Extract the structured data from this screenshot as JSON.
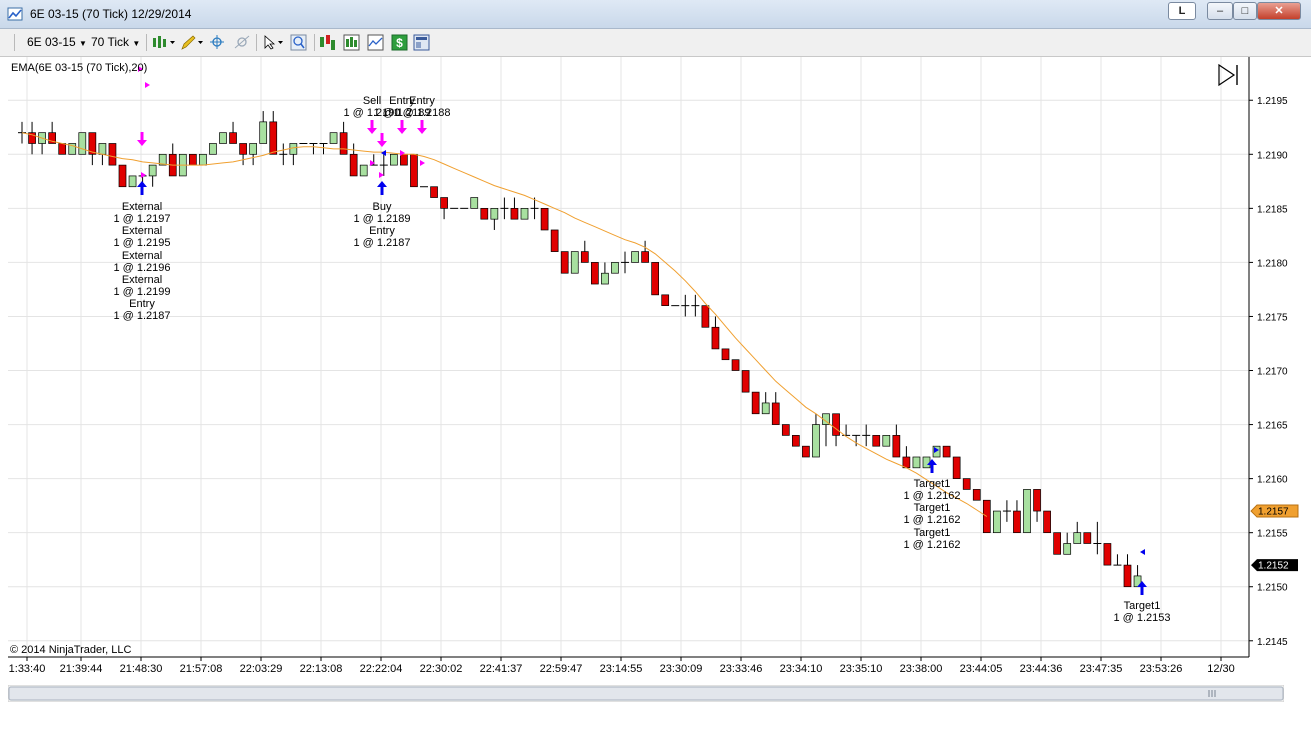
{
  "window": {
    "title": "6E 03-15 (70 Tick)  12/29/2014",
    "btn_l": "L",
    "btn_min": "–",
    "btn_max": "□",
    "btn_close": "✕"
  },
  "toolbar": {
    "instrument": "6E 03-15",
    "interval": "70 Tick",
    "icons": [
      "bar-style-icon",
      "pencil-draw-icon",
      "crosshair-icon",
      "magnet-icon",
      "pointer-icon",
      "zoom-icon",
      "strategies-icon",
      "indicators-icon",
      "chart-style-icon",
      "dollar-icon",
      "properties-icon"
    ]
  },
  "chart": {
    "indicator_label": "EMA(6E 03-15 (70 Tick),20)",
    "copyright": "© 2014 NinjaTrader, LLC",
    "ema_color": "#f0a030",
    "up_color": "#a8e0a0",
    "down_color": "#e00000",
    "ema_price_label": "1.2157",
    "last_price_label": "1.2152",
    "ema_price_value": 1.2157,
    "last_price_value": 1.2152,
    "y_ticks": [
      "1.2195",
      "1.2190",
      "1.2185",
      "1.2180",
      "1.2175",
      "1.2170",
      "1.2165",
      "1.2160",
      "1.2155",
      "1.2150",
      "1.2145"
    ],
    "x_labels": [
      "1:33:40",
      "21:39:44",
      "21:48:30",
      "21:57:08",
      "22:03:29",
      "22:13:08",
      "22:22:04",
      "22:30:02",
      "22:41:37",
      "22:59:47",
      "23:14:55",
      "23:30:09",
      "23:33:46",
      "23:34:10",
      "23:35:10",
      "23:38:00",
      "23:44:05",
      "23:44:36",
      "23:47:35",
      "23:53:26",
      "12/30"
    ],
    "annotations": {
      "left_exec": [
        "External",
        "1 @ 1.2197",
        "External",
        "1 @ 1.2195",
        "External",
        "1 @ 1.2196",
        "External",
        "1 @ 1.2199",
        "Entry",
        "1 @ 1.2187"
      ],
      "mid_buy": [
        "Buy",
        "1 @ 1.2189",
        "Entry",
        "1 @ 1.2187"
      ],
      "top_sell": [
        "Sell",
        "1 @ 1.2190"
      ],
      "top_entry1": [
        "Entry",
        "1 @ 1.2189"
      ],
      "top_entry2": [
        "Entry",
        "1 @ 1.2188"
      ],
      "target_group": [
        "Target1",
        "1 @ 1.2162",
        "Target1",
        "1 @ 1.2162",
        "Target1",
        "1 @ 1.2162"
      ],
      "target_last": [
        "Target1",
        "1 @ 1.2153"
      ]
    }
  },
  "chart_data": {
    "type": "candlestick",
    "title": "",
    "ylim": [
      1.21435,
      1.2199
    ],
    "grid": true,
    "series": [
      {
        "name": "EMA(6E 03-15 (70 Tick),20)",
        "values": [
          1.2192,
          1.21918,
          1.21915,
          1.21912,
          1.2191,
          1.21908,
          1.21905,
          1.21902,
          1.219,
          1.21898,
          1.21896,
          1.21895,
          1.21893,
          1.21892,
          1.21891,
          1.2189,
          1.2189,
          1.2189,
          1.2189,
          1.21891,
          1.21892,
          1.21893,
          1.21895,
          1.21897,
          1.21899,
          1.21902,
          1.21904,
          1.21906,
          1.21907,
          1.21907,
          1.21906,
          1.21905,
          1.21905,
          1.21904,
          1.21903,
          1.21902,
          1.21902,
          1.21901,
          1.219,
          1.219,
          1.21898,
          1.21895,
          1.21891,
          1.21887,
          1.21883,
          1.21879,
          1.21875,
          1.21871,
          1.21868,
          1.21865,
          1.21862,
          1.21858,
          1.21854,
          1.2185,
          1.21846,
          1.21841,
          1.21837,
          1.21833,
          1.21829,
          1.21825,
          1.21821,
          1.21818,
          1.21814,
          1.21808,
          1.218,
          1.21792,
          1.21783,
          1.21773,
          1.21762,
          1.21752,
          1.21741,
          1.2173,
          1.2172,
          1.2171,
          1.217,
          1.2169,
          1.21682,
          1.21674,
          1.21666,
          1.2166,
          1.21653,
          1.21646,
          1.21639,
          1.21633,
          1.21628,
          1.21623,
          1.21618,
          1.21614,
          1.2161,
          1.21605,
          1.21599,
          1.21593,
          1.21587,
          1.21582,
          1.21577,
          1.21571,
          1.21565
        ]
      }
    ],
    "candles": [
      [
        1.2192,
        1.2193,
        1.2191,
        1.2192
      ],
      [
        1.2192,
        1.2193,
        1.219,
        1.2191
      ],
      [
        1.2191,
        1.2192,
        1.219,
        1.2192
      ],
      [
        1.2192,
        1.2193,
        1.2191,
        1.2191
      ],
      [
        1.2191,
        1.2191,
        1.219,
        1.219
      ],
      [
        1.219,
        1.2191,
        1.219,
        1.2191
      ],
      [
        1.219,
        1.2192,
        1.219,
        1.2192
      ],
      [
        1.2192,
        1.2192,
        1.2189,
        1.219
      ],
      [
        1.219,
        1.2191,
        1.2189,
        1.2191
      ],
      [
        1.2191,
        1.2191,
        1.2189,
        1.2189
      ],
      [
        1.2189,
        1.2189,
        1.2187,
        1.2187
      ],
      [
        1.2187,
        1.2188,
        1.2187,
        1.2188
      ],
      [
        1.2188,
        1.2188,
        1.2187,
        1.2188
      ],
      [
        1.2188,
        1.2189,
        1.2187,
        1.2189
      ],
      [
        1.2189,
        1.219,
        1.2189,
        1.219
      ],
      [
        1.219,
        1.2191,
        1.2188,
        1.2188
      ],
      [
        1.2188,
        1.219,
        1.2188,
        1.219
      ],
      [
        1.219,
        1.219,
        1.2189,
        1.2189
      ],
      [
        1.2189,
        1.219,
        1.2189,
        1.219
      ],
      [
        1.219,
        1.2191,
        1.219,
        1.2191
      ],
      [
        1.2191,
        1.2192,
        1.2191,
        1.2192
      ],
      [
        1.2192,
        1.2193,
        1.2191,
        1.2191
      ],
      [
        1.2191,
        1.2191,
        1.2189,
        1.219
      ],
      [
        1.219,
        1.2191,
        1.2189,
        1.2191
      ],
      [
        1.2191,
        1.2194,
        1.2191,
        1.2193
      ],
      [
        1.2193,
        1.2194,
        1.219,
        1.219
      ],
      [
        1.219,
        1.2191,
        1.2189,
        1.219
      ],
      [
        1.219,
        1.2191,
        1.2189,
        1.2191
      ],
      [
        1.2191,
        1.2191,
        1.2191,
        1.2191
      ],
      [
        1.2191,
        1.2191,
        1.219,
        1.2191
      ],
      [
        1.2191,
        1.2191,
        1.219,
        1.2191
      ],
      [
        1.2191,
        1.2192,
        1.2191,
        1.2192
      ],
      [
        1.2192,
        1.2193,
        1.219,
        1.219
      ],
      [
        1.219,
        1.2191,
        1.2188,
        1.2188
      ],
      [
        1.2188,
        1.2189,
        1.2188,
        1.2189
      ],
      [
        1.2189,
        1.219,
        1.2189,
        1.2189
      ],
      [
        1.2189,
        1.219,
        1.2188,
        1.2189
      ],
      [
        1.2189,
        1.219,
        1.2189,
        1.219
      ],
      [
        1.219,
        1.219,
        1.2189,
        1.2189
      ],
      [
        1.219,
        1.219,
        1.2187,
        1.2187
      ],
      [
        1.2187,
        1.2187,
        1.2187,
        1.2187
      ],
      [
        1.2187,
        1.2187,
        1.2186,
        1.2186
      ],
      [
        1.2186,
        1.2186,
        1.2184,
        1.2185
      ],
      [
        1.2185,
        1.2185,
        1.2185,
        1.2185
      ],
      [
        1.2185,
        1.2185,
        1.2185,
        1.2185
      ],
      [
        1.2185,
        1.2186,
        1.2185,
        1.2186
      ],
      [
        1.2185,
        1.2185,
        1.2184,
        1.2184
      ],
      [
        1.2184,
        1.2185,
        1.2183,
        1.2185
      ],
      [
        1.2185,
        1.2186,
        1.2184,
        1.2185
      ],
      [
        1.2185,
        1.2186,
        1.2185,
        1.2184
      ],
      [
        1.2184,
        1.2185,
        1.2184,
        1.2185
      ],
      [
        1.2185,
        1.2186,
        1.2184,
        1.2185
      ],
      [
        1.2185,
        1.2185,
        1.2183,
        1.2183
      ],
      [
        1.2183,
        1.2183,
        1.2181,
        1.2181
      ],
      [
        1.2181,
        1.2181,
        1.2179,
        1.2179
      ],
      [
        1.2179,
        1.2181,
        1.2179,
        1.2181
      ],
      [
        1.2181,
        1.2182,
        1.218,
        1.218
      ],
      [
        1.218,
        1.218,
        1.2178,
        1.2178
      ],
      [
        1.2178,
        1.218,
        1.2178,
        1.2179
      ],
      [
        1.2179,
        1.218,
        1.2179,
        1.218
      ],
      [
        1.218,
        1.2181,
        1.2179,
        1.218
      ],
      [
        1.218,
        1.2181,
        1.218,
        1.2181
      ],
      [
        1.2181,
        1.2182,
        1.218,
        1.218
      ],
      [
        1.218,
        1.218,
        1.2177,
        1.2177
      ],
      [
        1.2177,
        1.2177,
        1.2176,
        1.2176
      ],
      [
        1.2176,
        1.2176,
        1.2176,
        1.2176
      ],
      [
        1.2176,
        1.2177,
        1.2175,
        1.2176
      ],
      [
        1.2176,
        1.2177,
        1.2175,
        1.2176
      ],
      [
        1.2176,
        1.2176,
        1.2174,
        1.2174
      ],
      [
        1.2174,
        1.2175,
        1.2172,
        1.2172
      ],
      [
        1.2172,
        1.2172,
        1.2171,
        1.2171
      ],
      [
        1.2171,
        1.2171,
        1.217,
        1.217
      ],
      [
        1.217,
        1.217,
        1.2168,
        1.2168
      ],
      [
        1.2168,
        1.2168,
        1.2166,
        1.2166
      ],
      [
        1.2166,
        1.2168,
        1.2166,
        1.2167
      ],
      [
        1.2167,
        1.2168,
        1.2165,
        1.2165
      ],
      [
        1.2165,
        1.2165,
        1.2164,
        1.2164
      ],
      [
        1.2164,
        1.2164,
        1.2163,
        1.2163
      ],
      [
        1.2163,
        1.2163,
        1.2162,
        1.2162
      ],
      [
        1.2162,
        1.2166,
        1.2162,
        1.2165
      ],
      [
        1.2165,
        1.2166,
        1.2163,
        1.2166
      ],
      [
        1.2166,
        1.2166,
        1.2163,
        1.2164
      ],
      [
        1.2164,
        1.2165,
        1.2164,
        1.2164
      ],
      [
        1.2164,
        1.2164,
        1.2163,
        1.2164
      ],
      [
        1.2164,
        1.2165,
        1.2163,
        1.2164
      ],
      [
        1.2164,
        1.2164,
        1.2163,
        1.2163
      ],
      [
        1.2163,
        1.2164,
        1.2163,
        1.2164
      ],
      [
        1.2164,
        1.2165,
        1.2162,
        1.2162
      ],
      [
        1.2162,
        1.2163,
        1.2161,
        1.2161
      ],
      [
        1.2161,
        1.2162,
        1.2161,
        1.2162
      ],
      [
        1.2161,
        1.2162,
        1.2161,
        1.2162
      ],
      [
        1.2162,
        1.2163,
        1.2162,
        1.2163
      ],
      [
        1.2163,
        1.2163,
        1.2162,
        1.2162
      ],
      [
        1.2162,
        1.2162,
        1.2161,
        1.216
      ],
      [
        1.216,
        1.216,
        1.2159,
        1.2159
      ],
      [
        1.2159,
        1.2159,
        1.2158,
        1.2158
      ],
      [
        1.2158,
        1.2158,
        1.2155,
        1.2155
      ],
      [
        1.2155,
        1.2157,
        1.2155,
        1.2157
      ],
      [
        1.2157,
        1.2158,
        1.2156,
        1.2157
      ],
      [
        1.2157,
        1.2158,
        1.2155,
        1.2155
      ],
      [
        1.2155,
        1.2159,
        1.2155,
        1.2159
      ],
      [
        1.2159,
        1.2159,
        1.2156,
        1.2157
      ],
      [
        1.2157,
        1.2157,
        1.2155,
        1.2155
      ],
      [
        1.2155,
        1.2155,
        1.2153,
        1.2153
      ],
      [
        1.2153,
        1.2155,
        1.2153,
        1.2154
      ],
      [
        1.2154,
        1.2156,
        1.2154,
        1.2155
      ],
      [
        1.2155,
        1.2155,
        1.2154,
        1.2154
      ],
      [
        1.2154,
        1.2156,
        1.2153,
        1.2154
      ],
      [
        1.2154,
        1.2154,
        1.2152,
        1.2152
      ],
      [
        1.2152,
        1.2153,
        1.2152,
        1.2152
      ],
      [
        1.2152,
        1.2153,
        1.215,
        1.215
      ],
      [
        1.215,
        1.2152,
        1.215,
        1.2151
      ]
    ]
  }
}
